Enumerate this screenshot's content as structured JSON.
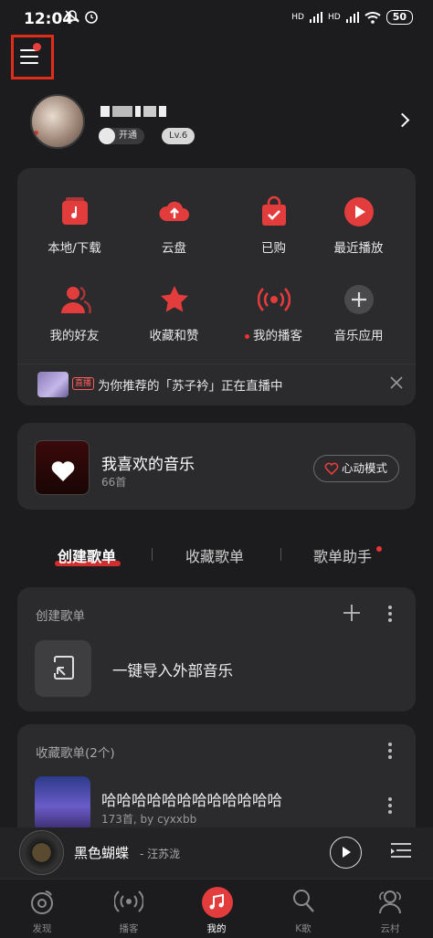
{
  "status_bar": {
    "time": "12:04",
    "signal_tag_1": "HD",
    "signal_tag_2": "HD",
    "battery": "50"
  },
  "profile": {
    "vip_label": "开通",
    "level": "Lv.6"
  },
  "quick_access": [
    {
      "label": "本地/下载",
      "icon": "music-file-icon"
    },
    {
      "label": "云盘",
      "icon": "cloud-upload-icon"
    },
    {
      "label": "已购",
      "icon": "shopping-bag-icon"
    },
    {
      "label": "最近播放",
      "icon": "play-circle-icon"
    },
    {
      "label": "我的好友",
      "icon": "friends-icon"
    },
    {
      "label": "收藏和赞",
      "icon": "star-icon"
    },
    {
      "label": "我的播客",
      "icon": "podcast-icon"
    },
    {
      "label": "音乐应用",
      "icon": "plus-circle-icon"
    }
  ],
  "live_banner": {
    "tag": "直播",
    "text": "为你推荐的「苏子衿」正在直播中"
  },
  "liked_music": {
    "title": "我喜欢的音乐",
    "count": "66首",
    "mode_button": "心动模式"
  },
  "tabs": {
    "created": "创建歌单",
    "collected": "收藏歌单",
    "helper": "歌单助手"
  },
  "created_section": {
    "header": "创建歌单",
    "import_label": "一键导入外部音乐"
  },
  "collected_section": {
    "header": "收藏歌单(2个)",
    "playlist_title": "哈哈哈哈哈哈哈哈哈哈哈哈",
    "playlist_meta": "173首, by cyxxbb"
  },
  "player": {
    "song": "黑色蝴蝶",
    "artist": "- 汪苏泷"
  },
  "bottom_nav": [
    {
      "label": "发现",
      "icon": "discover-icon"
    },
    {
      "label": "播客",
      "icon": "podcast-icon"
    },
    {
      "label": "我的",
      "icon": "my-music-icon"
    },
    {
      "label": "K歌",
      "icon": "karaoke-mic-icon"
    },
    {
      "label": "云村",
      "icon": "community-icon"
    }
  ],
  "colors": {
    "accent": "#e33c3c",
    "background": "#1c1c1e",
    "card": "#2b2b2d"
  }
}
